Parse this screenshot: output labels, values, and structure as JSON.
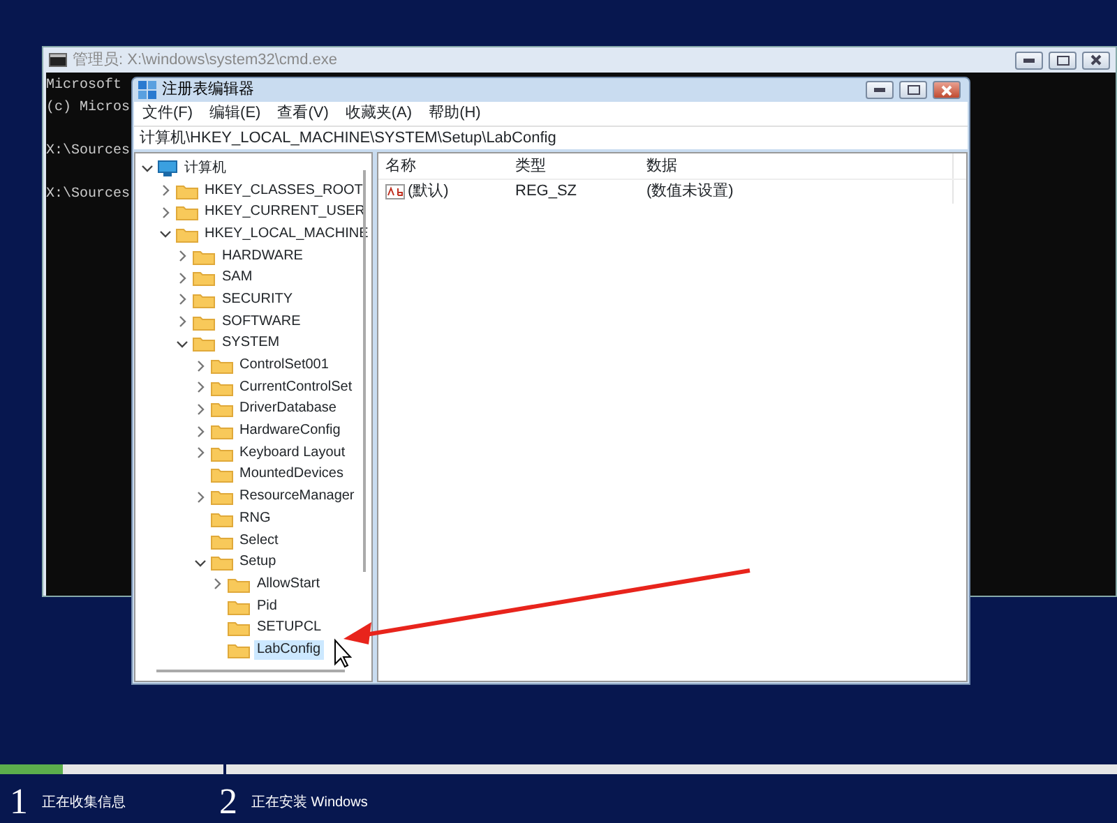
{
  "cmd_window": {
    "title": "管理员: X:\\windows\\system32\\cmd.exe",
    "lines": [
      "Microsoft",
      "(c) Micros",
      "X:\\Sources",
      "X:\\Sources"
    ]
  },
  "regedit": {
    "title": "注册表编辑器",
    "menu": [
      "文件(F)",
      "编辑(E)",
      "查看(V)",
      "收藏夹(A)",
      "帮助(H)"
    ],
    "address": "计算机\\HKEY_LOCAL_MACHINE\\SYSTEM\\Setup\\LabConfig",
    "tree": [
      {
        "label": "计算机",
        "kind": "computer",
        "expanded": true,
        "selected": false,
        "children": [
          {
            "label": "HKEY_CLASSES_ROOT",
            "kind": "branch",
            "expanded": false,
            "selected": false
          },
          {
            "label": "HKEY_CURRENT_USER",
            "kind": "branch",
            "expanded": false,
            "selected": false
          },
          {
            "label": "HKEY_LOCAL_MACHINE",
            "kind": "branch",
            "expanded": true,
            "selected": false,
            "children": [
              {
                "label": "HARDWARE",
                "kind": "branch",
                "expanded": false,
                "selected": false
              },
              {
                "label": "SAM",
                "kind": "branch",
                "expanded": false,
                "selected": false
              },
              {
                "label": "SECURITY",
                "kind": "branch",
                "expanded": false,
                "selected": false
              },
              {
                "label": "SOFTWARE",
                "kind": "branch",
                "expanded": false,
                "selected": false
              },
              {
                "label": "SYSTEM",
                "kind": "branch",
                "expanded": true,
                "selected": false,
                "children": [
                  {
                    "label": "ControlSet001",
                    "kind": "branch",
                    "expanded": false,
                    "selected": false
                  },
                  {
                    "label": "CurrentControlSet",
                    "kind": "branch",
                    "expanded": false,
                    "selected": false
                  },
                  {
                    "label": "DriverDatabase",
                    "kind": "branch",
                    "expanded": false,
                    "selected": false
                  },
                  {
                    "label": "HardwareConfig",
                    "kind": "branch",
                    "expanded": false,
                    "selected": false
                  },
                  {
                    "label": "Keyboard Layout",
                    "kind": "branch",
                    "expanded": false,
                    "selected": false
                  },
                  {
                    "label": "MountedDevices",
                    "kind": "leaf",
                    "selected": false
                  },
                  {
                    "label": "ResourceManager",
                    "kind": "branch",
                    "expanded": false,
                    "selected": false
                  },
                  {
                    "label": "RNG",
                    "kind": "leaf",
                    "selected": false
                  },
                  {
                    "label": "Select",
                    "kind": "leaf",
                    "selected": false
                  },
                  {
                    "label": "Setup",
                    "kind": "branch",
                    "expanded": true,
                    "selected": false,
                    "children": [
                      {
                        "label": "AllowStart",
                        "kind": "branch",
                        "expanded": false,
                        "selected": false
                      },
                      {
                        "label": "Pid",
                        "kind": "leaf",
                        "selected": false
                      },
                      {
                        "label": "SETUPCL",
                        "kind": "leaf",
                        "selected": false
                      },
                      {
                        "label": "LabConfig",
                        "kind": "leaf",
                        "selected": true
                      }
                    ]
                  }
                ]
              }
            ]
          }
        ]
      }
    ],
    "columns": [
      "名称",
      "类型",
      "数据"
    ],
    "values": [
      {
        "name": "(默认)",
        "type": "REG_SZ",
        "data": "(数值未设置)"
      }
    ]
  },
  "steps": [
    {
      "number": "1",
      "label": "正在收集信息",
      "level": 0.28
    },
    {
      "number": "2",
      "label": "正在安装 Windows",
      "level": 0
    }
  ]
}
